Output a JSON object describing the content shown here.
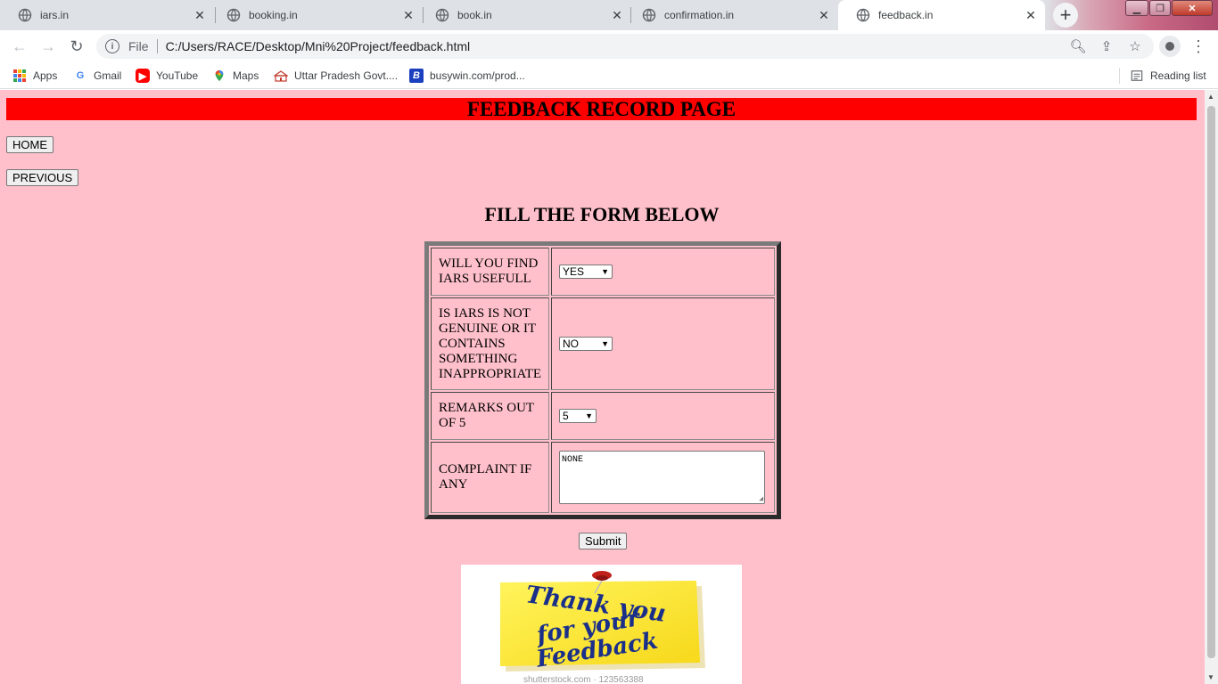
{
  "browser": {
    "tabs": [
      {
        "title": "iars.in",
        "active": false
      },
      {
        "title": "booking.in",
        "active": false
      },
      {
        "title": "book.in",
        "active": false
      },
      {
        "title": "confirmation.in",
        "active": false
      },
      {
        "title": "feedback.in",
        "active": true
      }
    ],
    "address": {
      "scheme_label": "File",
      "url": "C:/Users/RACE/Desktop/Mni%20Project/feedback.html"
    },
    "bookmarks": [
      {
        "label": "Apps",
        "icon": "apps-grid-icon"
      },
      {
        "label": "Gmail",
        "icon": "google-icon"
      },
      {
        "label": "YouTube",
        "icon": "youtube-icon"
      },
      {
        "label": "Maps",
        "icon": "maps-pin-icon"
      },
      {
        "label": "Uttar Pradesh Govt....",
        "icon": "govt-building-icon"
      },
      {
        "label": "busywin.com/prod...",
        "icon": "busy-b-icon"
      }
    ],
    "reading_list": "Reading list"
  },
  "page": {
    "header": "FEEDBACK RECORD PAGE",
    "home_button": "HOME",
    "previous_button": "PREVIOUS",
    "form_title": "FILL THE FORM BELOW",
    "form": [
      {
        "question": "WILL YOU FIND IARS USEFULL",
        "type": "select",
        "value": "YES"
      },
      {
        "question": "IS IARS IS NOT GENUINE OR IT CONTAINS SOMETHING INAPPROPRIATE",
        "type": "select",
        "value": "NO"
      },
      {
        "question": "REMARKS OUT OF 5",
        "type": "select",
        "value": "5"
      },
      {
        "question": "COMPLAINT IF ANY",
        "type": "textarea",
        "value": "NONE"
      }
    ],
    "submit_button": "Submit",
    "thanks_image": {
      "line1": "Thank you",
      "line2": "for your",
      "line3": "Feedback",
      "watermark": "shutterstock.com · 123563388"
    }
  },
  "colors": {
    "page_background": "#ffc0cb",
    "header_background": "#ff0000",
    "note_yellow": "#fff200"
  }
}
